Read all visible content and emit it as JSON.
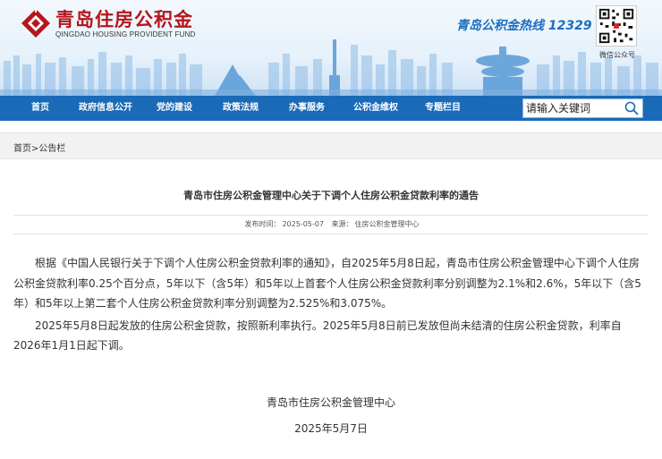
{
  "header": {
    "logo_cn": "青岛住房公积金",
    "logo_en": "QINGDAO HOUSING PROVIDENT FUND",
    "hotline": "青岛公积金热线 12329",
    "qr_label": "微信公众号",
    "brand_color": "#b5161d",
    "nav_color": "#1a6ab7"
  },
  "nav": {
    "items": [
      "首页",
      "政府信息公开",
      "党的建设",
      "政策法规",
      "办事服务",
      "公积金维权",
      "专题栏目"
    ],
    "search_placeholder": "请输入关键词"
  },
  "breadcrumb": {
    "home": "首页",
    "separator": ">",
    "current": "公告栏"
  },
  "article": {
    "title": "青岛市住房公积金管理中心关于下调个人住房公积金贷款利率的通告",
    "publish_label": "发布时间：",
    "publish_date": "2025-05-07",
    "source_label": "来源：",
    "source": "住房公积金管理中心",
    "paragraphs": [
      "根据《中国人民银行关于下调个人住房公积金贷款利率的通知》，自2025年5月8日起，青岛市住房公积金管理中心下调个人住房公积金贷款利率0.25个百分点，5年以下（含5年）和5年以上首套个人住房公积金贷款利率分别调整为2.1%和2.6%，5年以下（含5年）和5年以上第二套个人住房公积金贷款利率分别调整为2.525%和3.075%。",
      "2025年5月8日起发放的住房公积金贷款，按照新利率执行。2025年5月8日前已发放但尚未结清的住房公积金贷款，利率自2026年1月1日起下调。"
    ],
    "signature_org": "青岛市住房公积金管理中心",
    "signature_date": "2025年5月7日"
  }
}
